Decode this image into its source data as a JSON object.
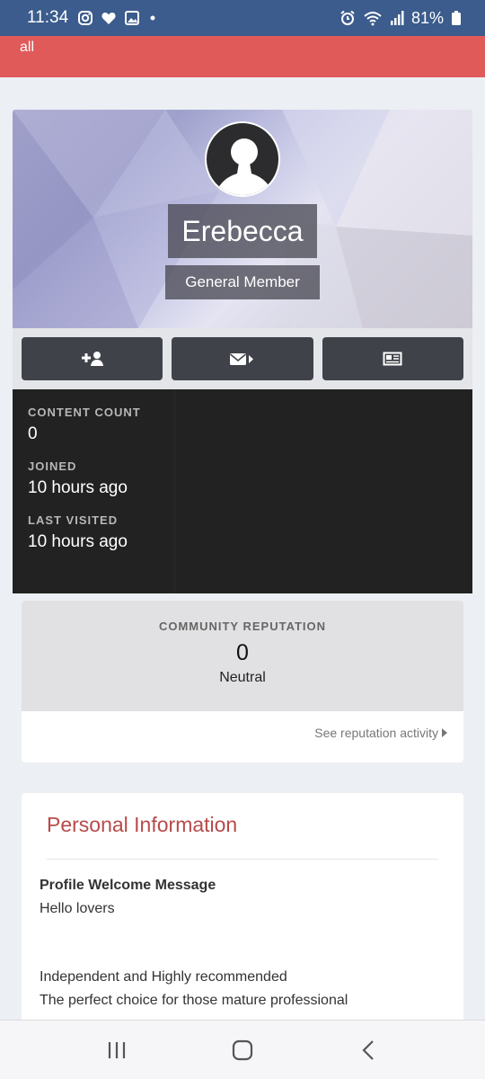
{
  "status_bar": {
    "time": "11:34",
    "battery": "81%",
    "icons": [
      "instagram-icon",
      "heart-icon",
      "image-icon",
      "dot-icon",
      "alarm-icon",
      "wifi-icon",
      "signal-icon",
      "battery-icon"
    ]
  },
  "top_bar": {
    "text": "all"
  },
  "profile": {
    "name": "Erebecca",
    "role": "General Member",
    "actions": [
      "follow-icon",
      "message-icon",
      "activity-icon"
    ]
  },
  "stats": {
    "content_count": {
      "label": "CONTENT COUNT",
      "value": "0"
    },
    "joined": {
      "label": "JOINED",
      "value": "10 hours ago"
    },
    "last_visited": {
      "label": "LAST VISITED",
      "value": "10 hours ago"
    }
  },
  "reputation": {
    "label": "COMMUNITY REPUTATION",
    "value": "0",
    "status": "Neutral",
    "link": "See reputation activity"
  },
  "personal_info": {
    "title": "Personal Information",
    "welcome_label": "Profile Welcome Message",
    "lines": [
      "Hello lovers",
      "Independent and Highly recommended",
      "The perfect choice for those mature professional"
    ]
  },
  "colors": {
    "status_bar": "#3b5c8c",
    "top_bar": "#e05a5a",
    "accent_title": "#b84a4a",
    "stats_bg": "#222222"
  }
}
